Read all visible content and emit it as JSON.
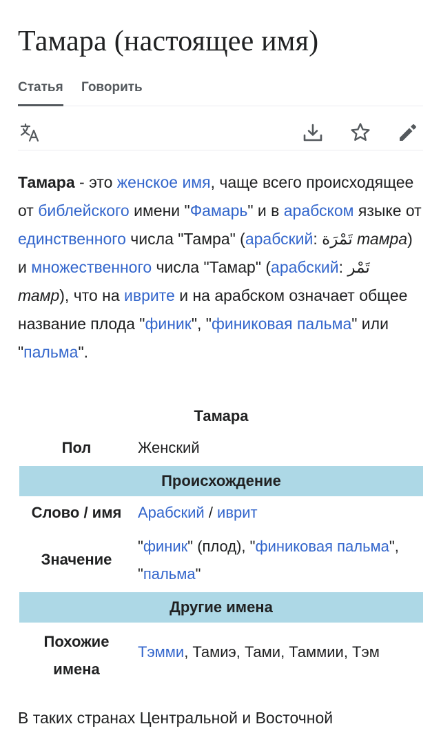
{
  "article": {
    "title": "Тамара (настоящее имя)"
  },
  "tabs": [
    {
      "label": "Статья"
    },
    {
      "label": "Говорить"
    }
  ],
  "toolbar": {
    "icons": [
      "translate-icon",
      "download-icon",
      "star-icon",
      "edit-pencil-icon"
    ]
  },
  "intro": {
    "p1": "Тамара",
    "p2": " - это ",
    "l_female_name": "женское имя",
    "p3": ", чаще всего происходящее от ",
    "l_biblical": "библейского",
    "p4": " имени \"",
    "l_famar": "Фамарь",
    "p5": "\" и в ",
    "l_arabic1": "арабском",
    "p6": " языке от ",
    "l_singular": "единственного",
    "p7": " числа \"Тамра\" (",
    "l_arabic2": "арабский",
    "p8": ": ",
    "ar_tamra": "تَمْرَة",
    "p9": " ",
    "it_tamra": "тамра",
    "p10": ") и ",
    "l_plural": "множественного",
    "p11": " числа \"Тамар\" (",
    "l_arabic3": "арабский",
    "p12": ": ",
    "ar_tamr": "تَمْر",
    "p13": " ",
    "it_tamr": "тамр",
    "p14": "), что на ",
    "l_hebrew": "иврите",
    "p15": " и на арабском означает общее название плода \"",
    "l_date": "финик",
    "p16": "\", \"",
    "l_date_palm": "финиковая пальма",
    "p17": "\" или \"",
    "l_palm": "пальма",
    "p18": "\"."
  },
  "infobox": {
    "caption": "Тамара",
    "gender_label": "Пол",
    "gender_value": "Женский",
    "origin_header": "Происхождение",
    "word_label": "Слово / имя",
    "word_link1": "Арабский",
    "word_sep": " / ",
    "word_link2": "иврит",
    "meaning_label": "Значение",
    "meaning_q1": "\"",
    "meaning_link1": "финик",
    "meaning_t1": "\" (плод), \"",
    "meaning_link2": "финиковая пальма",
    "meaning_t2": "\", \"",
    "meaning_link3": "пальма",
    "meaning_t3": "\"",
    "other_header": "Другие имена",
    "similar_label_1": "Похожие",
    "similar_label_2": "имена",
    "similar_link": "Тэмми",
    "similar_rest": ", Тамиэ, Тами, Таммии, Тэм"
  },
  "continuation": {
    "text": "В таких странах Центральной и Восточной"
  },
  "colors": {
    "link": "#3366cc",
    "text": "#202122",
    "infobox_header_bg": "#add8e6",
    "tab_text": "#54595d",
    "bottom_accent": "#8a2be2"
  }
}
